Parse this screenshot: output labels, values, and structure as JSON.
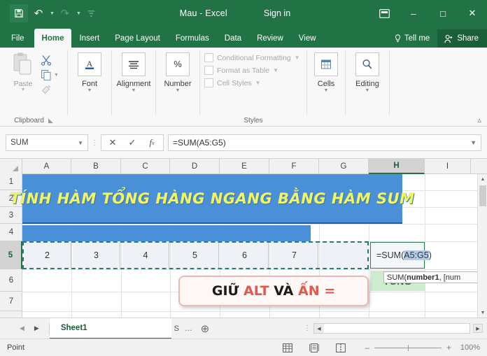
{
  "titlebar": {
    "document_title": "Mau  -  Excel",
    "signin_label": "Sign in",
    "qat": [
      {
        "name": "save-icon",
        "label": "Save"
      },
      {
        "name": "undo-icon",
        "label": "Undo"
      },
      {
        "name": "redo-icon",
        "label": "Redo"
      },
      {
        "name": "customize-qat-icon",
        "label": "Customize Quick Access Toolbar"
      }
    ],
    "window_controls": {
      "ribbon_display": "Ribbon Display Options",
      "minimize": "–",
      "maximize": "□",
      "close": "✕"
    }
  },
  "tabs": {
    "items": [
      {
        "label": "File",
        "active": false
      },
      {
        "label": "Home",
        "active": true
      },
      {
        "label": "Insert",
        "active": false
      },
      {
        "label": "Page Layout",
        "active": false
      },
      {
        "label": "Formulas",
        "active": false
      },
      {
        "label": "Data",
        "active": false
      },
      {
        "label": "Review",
        "active": false
      },
      {
        "label": "View",
        "active": false
      }
    ],
    "tell_me": "Tell me",
    "share": "Share"
  },
  "ribbon": {
    "clipboard": {
      "paste_label": "Paste",
      "group_label": "Clipboard",
      "cut_icon": "scissors-icon",
      "copy_icon": "copy-icon",
      "format_painter_icon": "format-painter-icon"
    },
    "font_label": "Font",
    "alignment_label": "Alignment",
    "number_label": "Number",
    "styles": {
      "group_label": "Styles",
      "items": [
        "Conditional Formatting",
        "Format as Table",
        "Cell Styles"
      ]
    },
    "cells_label": "Cells",
    "editing_label": "Editing",
    "collapse_label": "Collapse the Ribbon"
  },
  "formula_bar": {
    "name_box_value": "SUM",
    "cancel_icon": "cancel-icon",
    "enter_icon": "enter-icon",
    "insert_function_icon": "insert-function-icon",
    "formula_value": "=SUM(A5:G5)"
  },
  "grid": {
    "columns": [
      "A",
      "B",
      "C",
      "D",
      "E",
      "F",
      "G",
      "H",
      "I"
    ],
    "selected_column": "H",
    "rows": [
      "1",
      "2",
      "3",
      "4",
      "5",
      "6",
      "7"
    ],
    "selected_row": "5",
    "banner_text": "TÍNH HÀM TỔNG HÀNG NGANG BẰNG HÀM SUM",
    "banner_bg": "#4a90d9",
    "banner_color": "#f2f55e",
    "data_row_values": [
      "2",
      "3",
      "4",
      "5",
      "6",
      "7",
      ""
    ],
    "active_cell_prefix": "=SUM(",
    "active_cell_ref": "A5:G5",
    "active_cell_suffix": ")",
    "tooltip_prefix": "SUM(",
    "tooltip_bold": "number1",
    "tooltip_suffix": ", [num",
    "total_cell_text": "TỔNG"
  },
  "callout": {
    "part1": "GIỮ ",
    "part2": "ALT",
    "part3": " VÀ ",
    "part4": "ẤN =",
    "accent_color": "#e2584b"
  },
  "sheet_tabs": {
    "prev_label": "◀",
    "next_label": "▶",
    "sheets": [
      "Sheet1"
    ],
    "scroll_hint": "S",
    "overflow": "…",
    "add_label": "+"
  },
  "statusbar": {
    "mode": "Point",
    "views": [
      "normal-view-icon",
      "page-layout-icon",
      "page-break-preview-icon"
    ],
    "zoom_out": "–",
    "zoom_in": "+",
    "zoom_level": "100%"
  }
}
